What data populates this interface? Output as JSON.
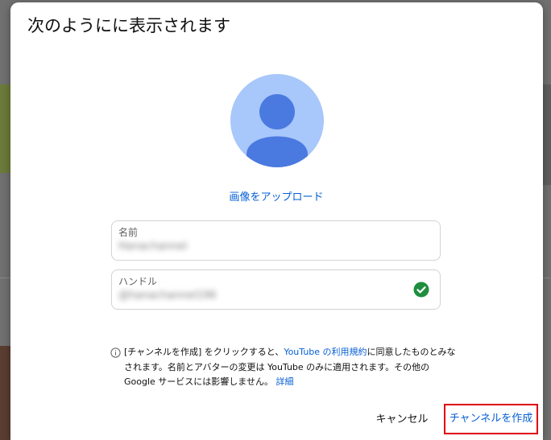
{
  "dialog": {
    "title": "次のようにに表示されます",
    "upload_link": "画像をアップロード",
    "name_field": {
      "label": "名前",
      "value": "Hanachannel"
    },
    "handle_field": {
      "label": "ハンドル",
      "value": "@hanachannel196",
      "status_icon": "check-circle-icon",
      "status_color": "#1e8e3e"
    },
    "notice": {
      "text_1": "[チャンネルを作成] をクリックすると、",
      "link_terms": "YouTube の利用規約",
      "text_2": "に同意したものとみなされます。名前とアバターの変更は YouTube のみに適用されます。その他の Google サービスには影響しません。",
      "link_details": "詳細"
    },
    "cancel_label": "キャンセル",
    "create_label": "チャンネルを作成"
  },
  "colors": {
    "accent": "#065fd4",
    "avatar_bg": "#a8c7fa",
    "avatar_fg": "#4a79e0",
    "highlight": "#e0000d"
  }
}
